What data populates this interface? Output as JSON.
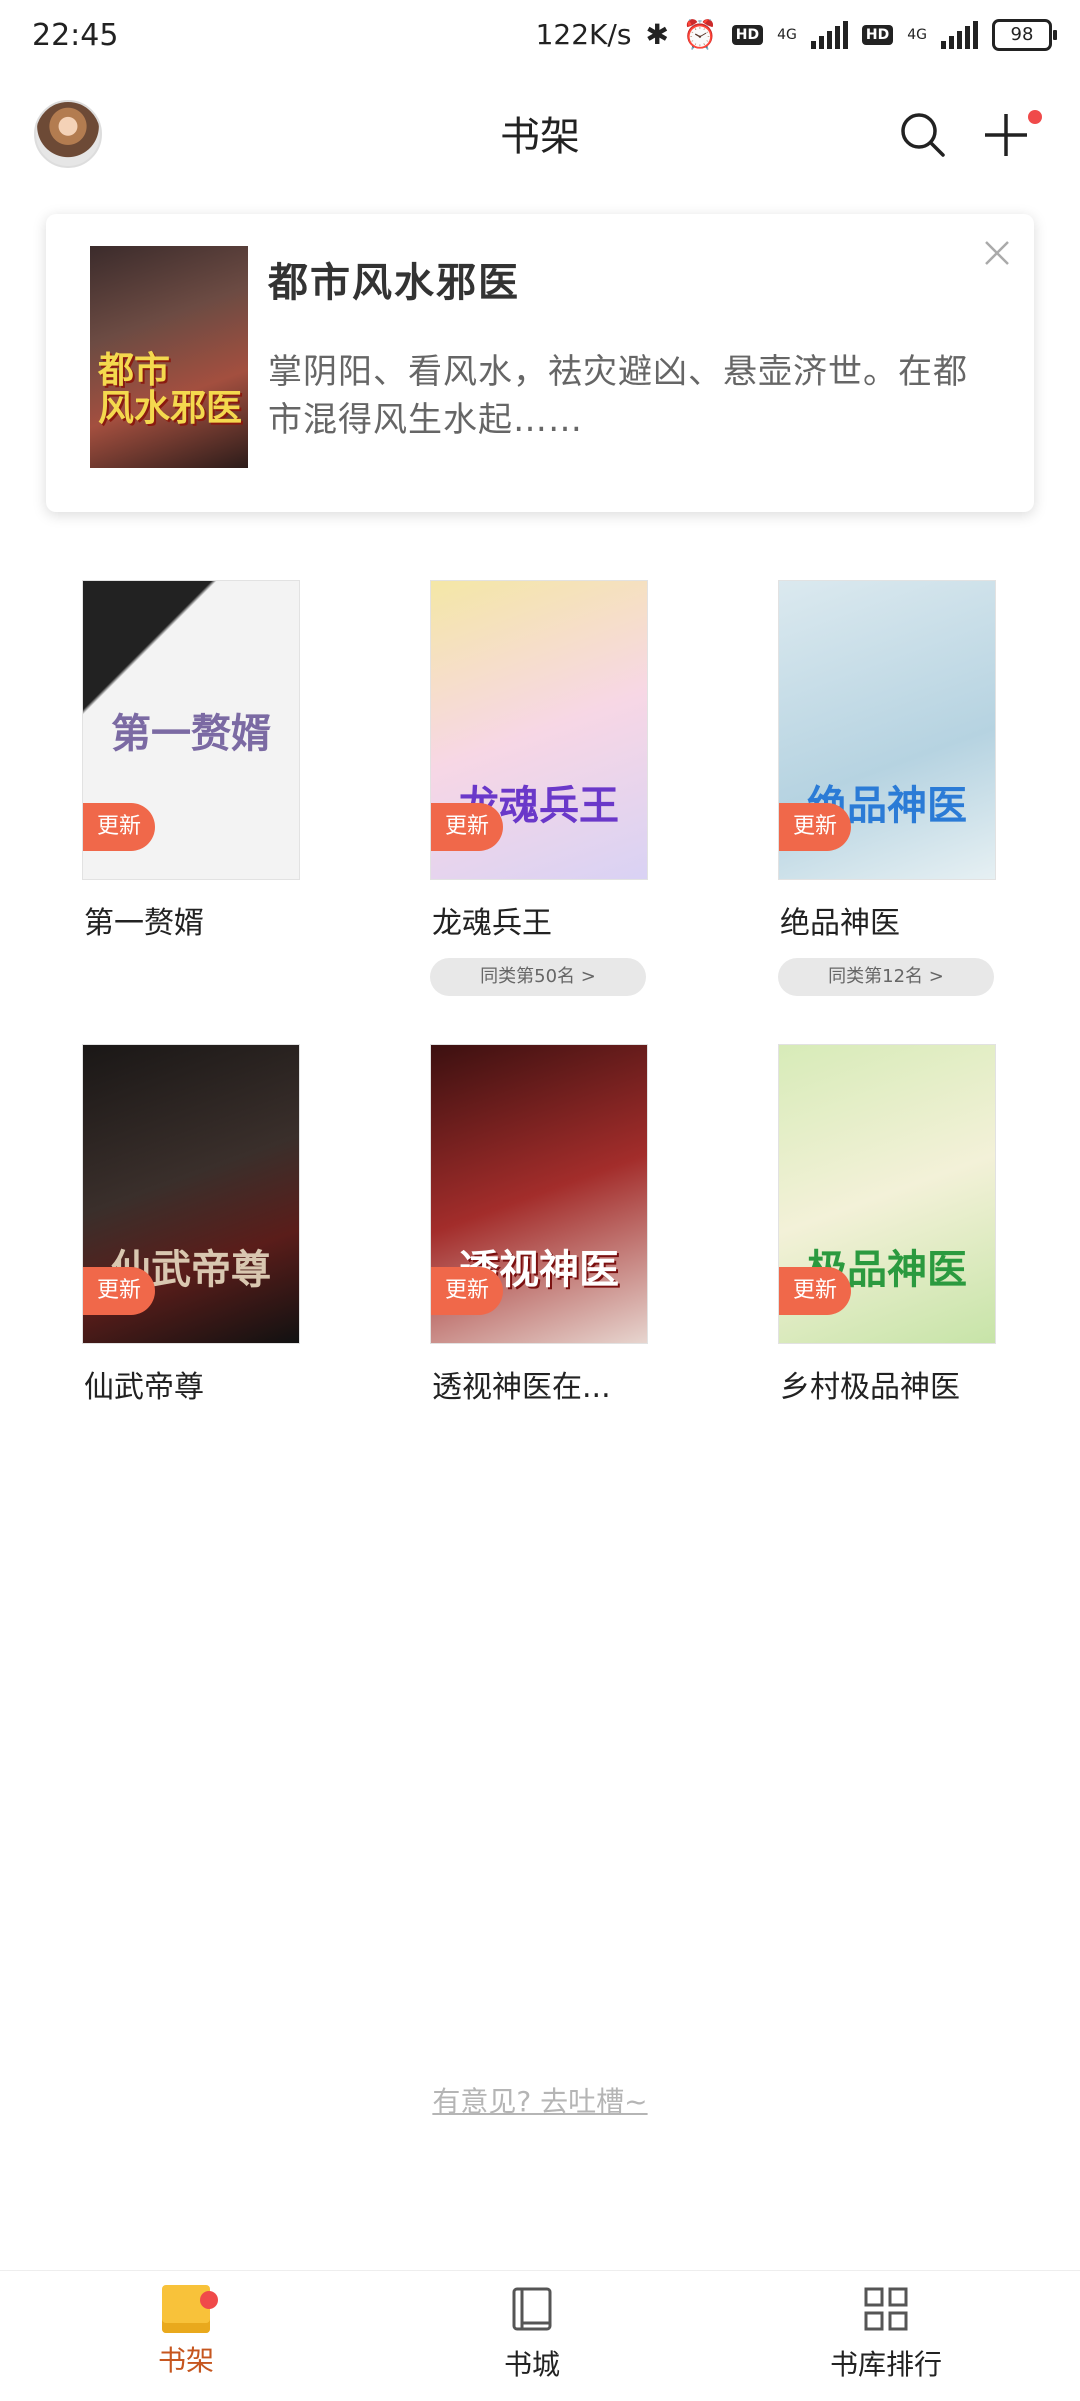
{
  "status_bar": {
    "time": "22:45",
    "net_speed": "122K/s",
    "battery": "98",
    "net1": "4G",
    "net2": "4G",
    "hd": "HD"
  },
  "header": {
    "title": "书架"
  },
  "promo": {
    "title": "都市风水邪医",
    "description": "掌阴阳、看风水，祛灾避凶、悬壶济世。在都市混得风生水起……",
    "cover_text": "都市\n风水邪医"
  },
  "books": [
    {
      "title": "第一赘婿",
      "badge": "更新",
      "cover_text": "第一赘婿",
      "cover_color": "#f3f3f3",
      "text_color": "#7b6aa3"
    },
    {
      "title": "龙魂兵王",
      "badge": "更新",
      "cover_text": "龙魂兵王",
      "cover_color": "#f4e7a6",
      "text_color": "#6a38c9",
      "rank": "同类第50名 >"
    },
    {
      "title": "绝品神医",
      "badge": "更新",
      "cover_text": "绝品神医",
      "cover_color": "#dbe9ef",
      "text_color": "#2b7bd6",
      "rank": "同类第12名 >"
    },
    {
      "title": "仙武帝尊",
      "badge": "更新",
      "cover_text": "仙武帝尊",
      "cover_color": "#2a2524",
      "text_color": "#d9c7b0"
    },
    {
      "title": "透视神医在...",
      "badge": "更新",
      "cover_text": "透视神医",
      "cover_color": "#a32d2b",
      "text_color": "#ffffff"
    },
    {
      "title": "乡村极品神医",
      "badge": "更新",
      "cover_text": "极品神医",
      "cover_color": "#d7ebb8",
      "text_color": "#2b9a3f"
    }
  ],
  "feedback": "有意见? 去吐槽~",
  "nav": {
    "shelf": "书架",
    "store": "书城",
    "rank": "书库排行"
  },
  "colors": {
    "accent": "#c6561f",
    "badge": "#f0684a",
    "notify": "#f04a4a"
  }
}
